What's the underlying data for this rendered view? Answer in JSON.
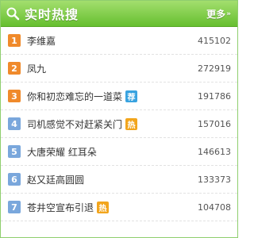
{
  "header": {
    "title": "实时热搜",
    "more_label": "更多",
    "more_arrow": "»",
    "icon": "search-magnifier-icon"
  },
  "colors": {
    "header_green": "#66bf2f",
    "rank_top": "#f08a2b",
    "rank_normal": "#7aa7dc",
    "tag_recommend": "#39a3e0",
    "tag_hot": "#f2a51c"
  },
  "items": [
    {
      "rank": "1",
      "title": "李维嘉",
      "count": "415102",
      "tag": ""
    },
    {
      "rank": "2",
      "title": "凤九",
      "count": "272919",
      "tag": ""
    },
    {
      "rank": "3",
      "title": "你和初恋难忘的一道菜",
      "count": "191786",
      "tag": "荐"
    },
    {
      "rank": "4",
      "title": "司机感觉不对赶紧关门",
      "count": "157016",
      "tag": "热"
    },
    {
      "rank": "5",
      "title": "大唐荣耀 红耳朵",
      "count": "146613",
      "tag": ""
    },
    {
      "rank": "6",
      "title": "赵又廷高圆圆",
      "count": "133373",
      "tag": ""
    },
    {
      "rank": "7",
      "title": "苍井空宣布引退",
      "count": "104708",
      "tag": "热"
    }
  ]
}
